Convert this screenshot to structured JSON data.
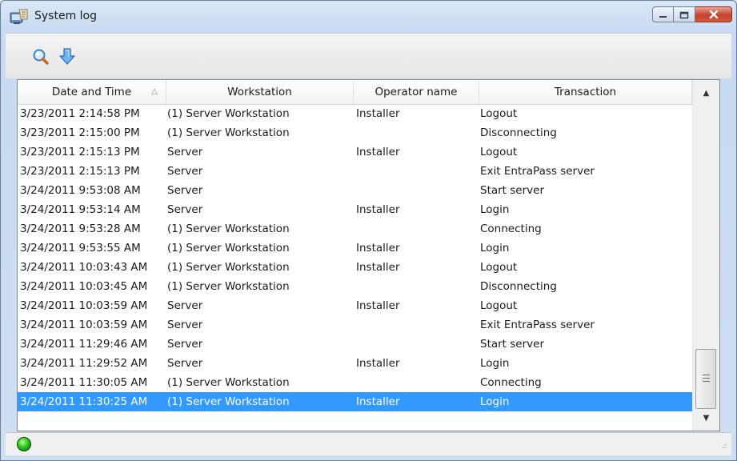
{
  "window": {
    "title": "System log",
    "icon": "system-log-app-icon",
    "controls": {
      "minimize_icon": "minimize-icon",
      "maximize_icon": "maximize-icon",
      "close_icon": "close-icon",
      "close_color": "#c7432a"
    }
  },
  "toolbar": {
    "buttons": [
      {
        "icon": "magnifier-icon"
      },
      {
        "icon": "download-arrow-icon"
      }
    ]
  },
  "table": {
    "columns": [
      {
        "label": "Date and Time",
        "sort_icon": "sort-ascending-icon",
        "sort_glyph": "△"
      },
      {
        "label": "Workstation"
      },
      {
        "label": "Operator name"
      },
      {
        "label": "Transaction"
      }
    ],
    "selection_color": "#3399ff",
    "rows": [
      {
        "datetime": "3/23/2011 2:14:58 PM",
        "workstation": "(1) Server Workstation",
        "operator": "Installer",
        "transaction": "Logout"
      },
      {
        "datetime": "3/23/2011 2:15:00 PM",
        "workstation": "(1) Server Workstation",
        "operator": "",
        "transaction": "Disconnecting"
      },
      {
        "datetime": "3/23/2011 2:15:13 PM",
        "workstation": "Server",
        "operator": "Installer",
        "transaction": "Logout"
      },
      {
        "datetime": "3/23/2011 2:15:13 PM",
        "workstation": "Server",
        "operator": "",
        "transaction": "Exit EntraPass server"
      },
      {
        "datetime": "3/24/2011 9:53:08 AM",
        "workstation": "Server",
        "operator": "",
        "transaction": "Start server"
      },
      {
        "datetime": "3/24/2011 9:53:14 AM",
        "workstation": "Server",
        "operator": "Installer",
        "transaction": "Login"
      },
      {
        "datetime": "3/24/2011 9:53:28 AM",
        "workstation": "(1) Server Workstation",
        "operator": "",
        "transaction": "Connecting"
      },
      {
        "datetime": "3/24/2011 9:53:55 AM",
        "workstation": "(1) Server Workstation",
        "operator": "Installer",
        "transaction": "Login"
      },
      {
        "datetime": "3/24/2011 10:03:43 AM",
        "workstation": "(1) Server Workstation",
        "operator": "Installer",
        "transaction": "Logout"
      },
      {
        "datetime": "3/24/2011 10:03:45 AM",
        "workstation": "(1) Server Workstation",
        "operator": "",
        "transaction": "Disconnecting"
      },
      {
        "datetime": "3/24/2011 10:03:59 AM",
        "workstation": "Server",
        "operator": "Installer",
        "transaction": "Logout"
      },
      {
        "datetime": "3/24/2011 10:03:59 AM",
        "workstation": "Server",
        "operator": "",
        "transaction": "Exit EntraPass server"
      },
      {
        "datetime": "3/24/2011 11:29:46 AM",
        "workstation": "Server",
        "operator": "",
        "transaction": "Start server"
      },
      {
        "datetime": "3/24/2011 11:29:52 AM",
        "workstation": "Server",
        "operator": "Installer",
        "transaction": "Login"
      },
      {
        "datetime": "3/24/2011 11:30:05 AM",
        "workstation": "(1) Server Workstation",
        "operator": "",
        "transaction": "Connecting"
      },
      {
        "datetime": "3/24/2011 11:30:25 AM",
        "workstation": "(1) Server Workstation",
        "operator": "Installer",
        "transaction": "Login",
        "selected": true
      }
    ],
    "scrollbar": {
      "up_icon": "scroll-up-arrow-icon",
      "down_icon": "scroll-down-arrow-icon",
      "up_glyph": "▲",
      "down_glyph": "▼",
      "position": 1.0
    }
  },
  "statusbar": {
    "indicator_icon": "connection-status-led-icon",
    "indicator_color": "#2fc41c",
    "text": "",
    "resize_icon": "resize-grip-icon",
    "resize_glyph": ".::"
  }
}
